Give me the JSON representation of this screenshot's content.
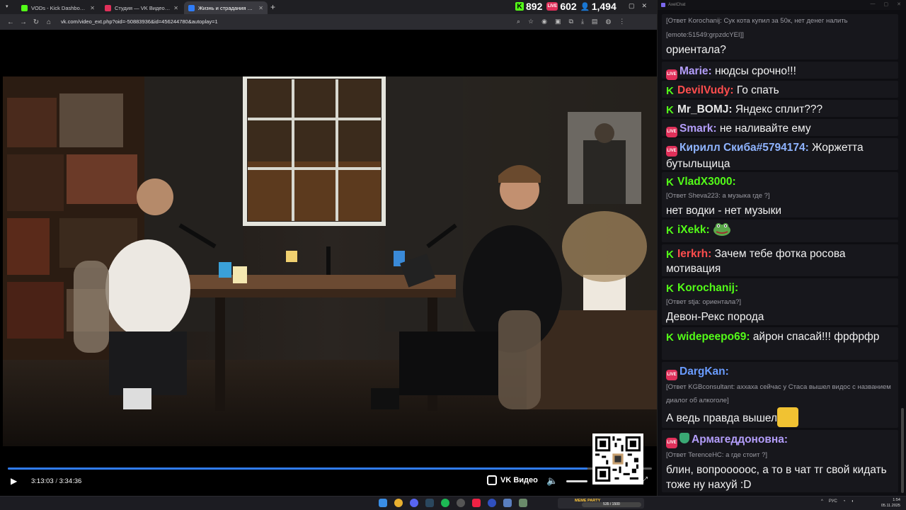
{
  "browser": {
    "tabs": [
      {
        "label": "VODs - Kick Dashboard",
        "color": "#53fc18",
        "active": false
      },
      {
        "label": "Студия — VK Видео Live",
        "color": "#e0305a",
        "active": false
      },
      {
        "label": "Жизнь и страдания Романа А",
        "color": "#2f7cf6",
        "active": true
      }
    ],
    "url": "vk.com/video_ext.php?oid=-50883936&id=456244780&autoplay=1"
  },
  "viewers": {
    "kick": "892",
    "vk": "602",
    "total": "1,494"
  },
  "player": {
    "current_time": "3:13:03",
    "separator": "/",
    "duration": "3:34:36",
    "progress_fraction": 0.9,
    "brand": "VK Видео"
  },
  "chat": {
    "app_title": "AxelChat",
    "messages": [
      {
        "platform": "kick",
        "user": "Korochanij",
        "user_color": "#53fc18",
        "reply": "",
        "text": "",
        "partial_top": "[Ответ Korochanij: Сук кота купил за 50к, нет денег налить",
        "partial_mid": "[emote:51549:grpzdcYEI]]",
        "partial_end": "ориентала?"
      },
      {
        "platform": "vk",
        "user": "Marie:",
        "user_color": "#b39dfa",
        "reply": "",
        "text": "нюдсы срочно!!!"
      },
      {
        "platform": "kick",
        "user": "DevilVudy:",
        "user_color": "#ff4d4d",
        "reply": "",
        "text": "Го спать"
      },
      {
        "platform": "kick",
        "user": "Mr_BOMJ:",
        "user_color": "#e8e8e8",
        "reply": "",
        "text": "Яндекс сплит???"
      },
      {
        "platform": "vk",
        "user": "Smark:",
        "user_color": "#b39dfa",
        "reply": "",
        "text": "не наливайте ему"
      },
      {
        "platform": "vk",
        "user": "Кирилл Скиба#5794174:",
        "user_color": "#8fb4ff",
        "reply": "",
        "text": "Жоржетта бутыльщица"
      },
      {
        "platform": "kick",
        "user": "VladX3000:",
        "user_color": "#53fc18",
        "reply": "[Ответ Sheva223: а музыка где ?]",
        "text": "нет водки - нет музыки"
      },
      {
        "platform": "kick",
        "user": "iXekk:",
        "user_color": "#53fc18",
        "reply": "",
        "text": ""
      },
      {
        "platform": "kick",
        "user": "Ierkrh:",
        "user_color": "#ff4d4d",
        "reply": "",
        "text": "Зачем тебе фотка росова мотивация"
      },
      {
        "platform": "kick",
        "user": "Korochanij:",
        "user_color": "#53fc18",
        "reply": "[Ответ stja: ориентала?]",
        "text": "Девон-Рекс порода"
      },
      {
        "platform": "kick",
        "user": "widepeepo69:",
        "user_color": "#53fc18",
        "reply": "",
        "text": "айрон спасай!!! фрфрфр"
      },
      {
        "platform": "vk",
        "user": "DargKan:",
        "user_color": "#6a9cff",
        "reply": "[Ответ KGBconsultant: аххаха сейчас у Стаса вышел видос с названием диалог об алкоголе]",
        "text": "А ведь правда вышел"
      },
      {
        "platform": "vk",
        "user": "Армагеддоновна:",
        "user_color": "#b39dfa",
        "reply": "[Ответ TerenceHC: а где стоит ?]",
        "text": "блин, вопрооооос, а то в чат тг свой кидать тоже ну нахуй :D"
      }
    ]
  },
  "taskbar": {
    "widget_name": "MEME PARTY",
    "widget_progress": "535 / 1500",
    "language": "РУС",
    "time": "1:54",
    "date": "05.11.2025"
  }
}
